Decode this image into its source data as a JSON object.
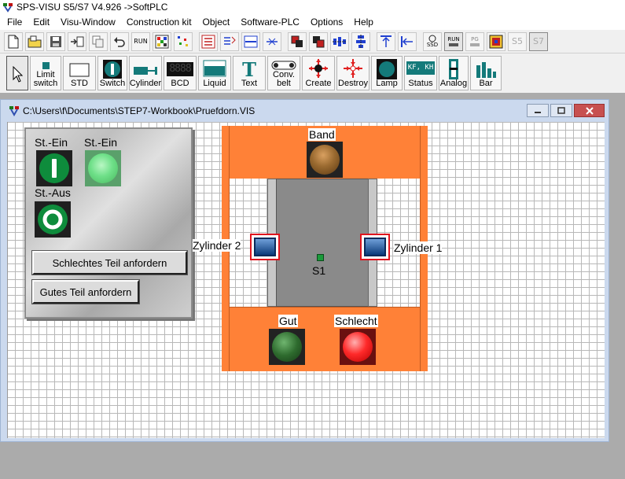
{
  "app": {
    "title": "SPS-VISU S5/S7 V4.926 ->SoftPLC"
  },
  "menu": [
    "File",
    "Edit",
    "Visu-Window",
    "Construction kit",
    "Object",
    "Software-PLC",
    "Options",
    "Help"
  ],
  "toolbar1": {
    "run_label": "RUN",
    "ssd_label": "SSD",
    "run_pg_labels": [
      "RUN",
      "PG"
    ],
    "s5_label": "S5",
    "s7_label": "S7"
  },
  "tools": [
    {
      "id": "pointer",
      "label": ""
    },
    {
      "id": "limit-switch",
      "label": "Limit switch"
    },
    {
      "id": "std",
      "label": "STD"
    },
    {
      "id": "switch",
      "label": "Switch"
    },
    {
      "id": "cylinder",
      "label": "Cylinder"
    },
    {
      "id": "bcd",
      "label": "BCD"
    },
    {
      "id": "liquid",
      "label": "Liquid"
    },
    {
      "id": "text",
      "label": "Text"
    },
    {
      "id": "conv-belt",
      "label": "Conv. belt"
    },
    {
      "id": "create",
      "label": "Create"
    },
    {
      "id": "destroy",
      "label": "Destroy"
    },
    {
      "id": "lamp",
      "label": "Lamp"
    },
    {
      "id": "status",
      "label": "Status"
    },
    {
      "id": "analog",
      "label": "Analog"
    },
    {
      "id": "bar",
      "label": "Bar"
    }
  ],
  "tool_icon_text": {
    "bcd": "8888",
    "status": "KF, KH"
  },
  "child_window": {
    "title": "C:\\Users\\f\\Documents\\STEP7-Workbook\\Pruefdorn.VIS"
  },
  "panel": {
    "st_ein_button_label": "St.-Ein",
    "st_ein_lamp_label": "St.-Ein",
    "st_aus_button_label": "St.-Aus",
    "bad_part_button": "Schlechtes Teil anfordern",
    "good_part_button": "Gutes Teil anfordern"
  },
  "machine": {
    "band_label": "Band",
    "cylinder2_label": "Zylinder 2",
    "cylinder1_label": "Zylinder 1",
    "sensor_label": "S1",
    "good_label": "Gut",
    "bad_label": "Schlecht"
  },
  "colors": {
    "orange": "#ff8137",
    "belt_gray": "#8a8a8a",
    "cylinder_blue": "#1c4c8c",
    "cylinder_border": "#e0141e",
    "lamp_red": "#ff2a2a",
    "lamp_green_off": "#2e6b2e",
    "band_lamp": "#8a5a22"
  }
}
